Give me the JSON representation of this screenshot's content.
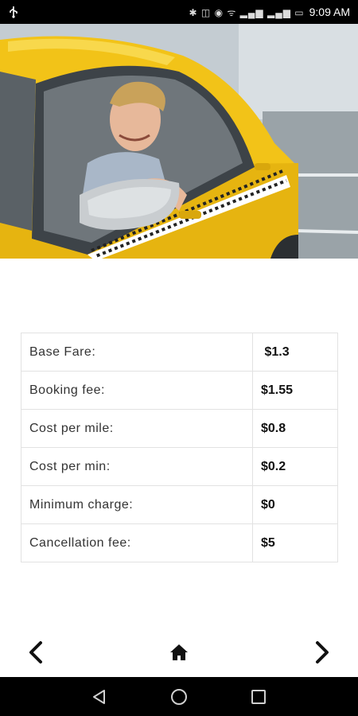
{
  "status_bar": {
    "time": "9:09 AM",
    "left_icon": "usb-icon",
    "right_icons_text": "✱ ◫ ◉ ᯤ ▂▄▆ ▂▄▆ ▭"
  },
  "hero": {
    "image": "driver-in-yellow-taxi"
  },
  "fares": [
    {
      "label": "Base Fare:",
      "value": " $1.3"
    },
    {
      "label": "Booking fee:",
      "value": "$1.55"
    },
    {
      "label": "Cost per mile:",
      "value": "$0.8"
    },
    {
      "label": "Cost per min:",
      "value": "$0.2"
    },
    {
      "label": "Minimum charge:",
      "value": "$0"
    },
    {
      "label": "Cancellation fee:",
      "value": "$5"
    }
  ],
  "nav": {
    "back_icon": "chevron-left-icon",
    "home_icon": "home-icon",
    "forward_icon": "chevron-right-icon"
  },
  "colors": {
    "taxi_yellow": "#f2c318",
    "table_border": "#e2e2e2"
  }
}
